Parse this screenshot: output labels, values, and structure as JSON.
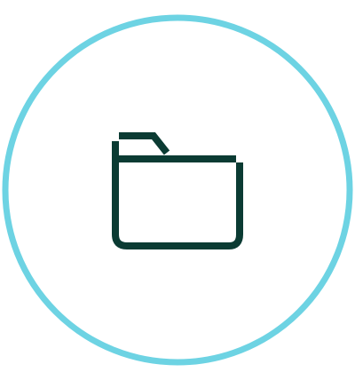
{
  "icon": {
    "name": "folder-icon",
    "stroke_color": "#0b3b33"
  },
  "ring": {
    "color": "#6dd3e3"
  }
}
